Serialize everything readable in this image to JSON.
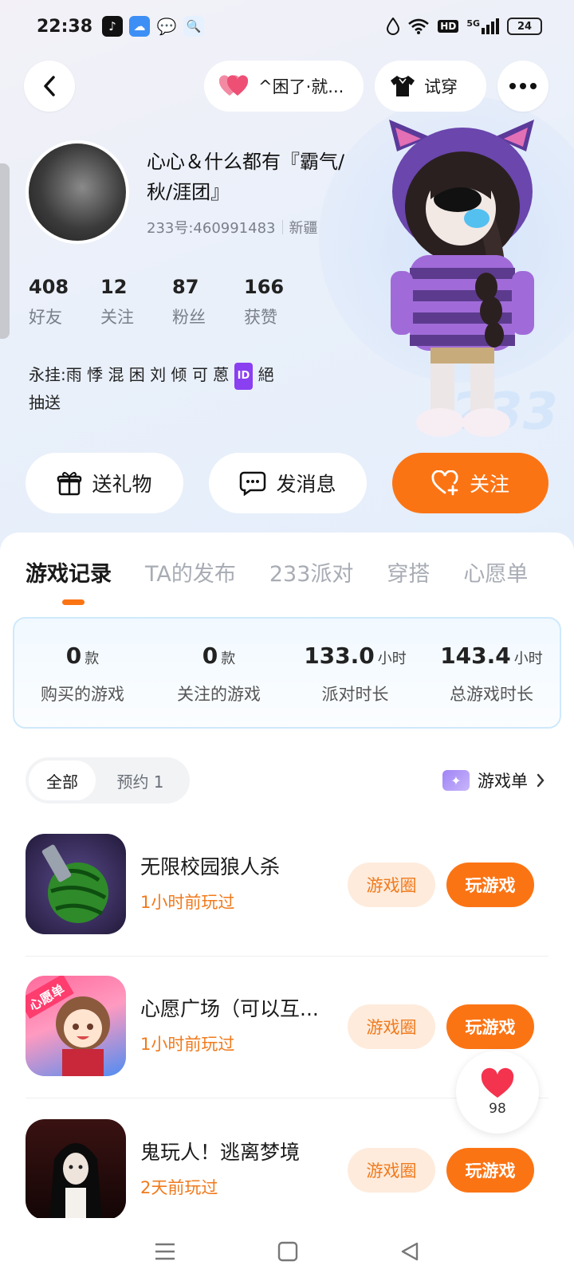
{
  "status_bar": {
    "time": "22:38",
    "hd": "HD",
    "network": "5G",
    "battery": "24"
  },
  "header": {
    "group_pill": "^困了·就...",
    "tryon_label": "试穿"
  },
  "profile": {
    "name": "心心＆什么都有『霸气/秋/涯团』",
    "uid": "233号:460991483",
    "region": "新疆",
    "bio_line1": "永挂:雨 悸 混 困 刘 倾 可 蒽",
    "id_badge": "ID",
    "bio_line1_end": "絕",
    "bio_line2": "抽送",
    "watermark": "233"
  },
  "stats": [
    {
      "value": "408",
      "label": "好友"
    },
    {
      "value": "12",
      "label": "关注"
    },
    {
      "value": "87",
      "label": "粉丝"
    },
    {
      "value": "166",
      "label": "获赞"
    }
  ],
  "actions": {
    "gift": "送礼物",
    "message": "发消息",
    "follow": "关注"
  },
  "tabs": [
    "游戏记录",
    "TA的发布",
    "233派对",
    "穿搭",
    "心愿单"
  ],
  "summary": [
    {
      "value": "0",
      "unit": "款",
      "label": "购买的游戏"
    },
    {
      "value": "0",
      "unit": "款",
      "label": "关注的游戏"
    },
    {
      "value": "133.0",
      "unit": "小时",
      "label": "派对时长"
    },
    {
      "value": "143.4",
      "unit": "小时",
      "label": "总游戏时长"
    }
  ],
  "filters": {
    "all": "全部",
    "reserved": "预约 1"
  },
  "game_list_link": "游戏单",
  "games": [
    {
      "title": "无限校园狼人杀",
      "time": "1小时前玩过",
      "circle": "游戏圈",
      "play": "玩游戏"
    },
    {
      "title": "心愿广场（可以互...",
      "time": "1小时前玩过",
      "circle": "游戏圈",
      "play": "玩游戏",
      "icon_badge": "心愿单"
    },
    {
      "title": "鬼玩人！逃离梦境",
      "time": "2天前玩过",
      "circle": "游戏圈",
      "play": "玩游戏"
    }
  ],
  "like_float": {
    "count": "98"
  },
  "colors": {
    "accent": "#fb7414",
    "accent_light": "#feebdc",
    "heart": "#f05a78"
  }
}
